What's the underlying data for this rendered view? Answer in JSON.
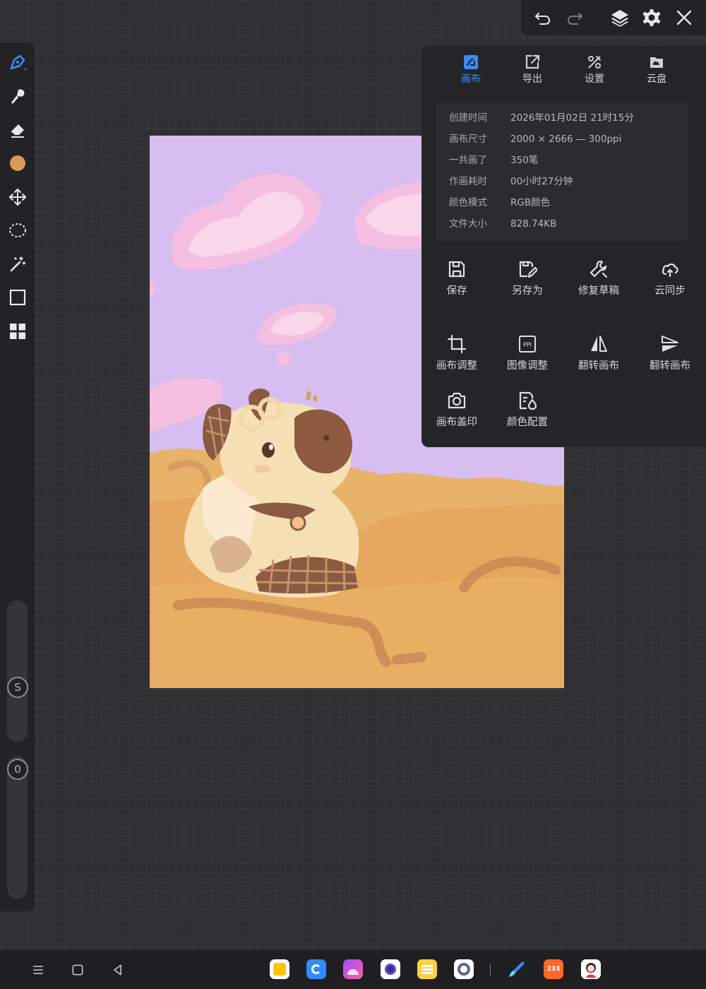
{
  "top_toolbar": {
    "icons": [
      "undo-icon",
      "redo-icon",
      "layers-icon",
      "gear-icon",
      "close-icon"
    ]
  },
  "left_toolbar": {
    "tools": [
      "pen-icon",
      "brush-icon",
      "eraser-icon",
      "color-swatch",
      "move-icon",
      "lasso-icon",
      "magic-wand-icon",
      "rectangle-select-icon",
      "grid-icon"
    ],
    "current_color": "#D89A5C",
    "size_slider_label": "S",
    "opacity_slider_label": "0"
  },
  "panel": {
    "tabs": [
      {
        "label": "画布",
        "icon": "canvas-icon",
        "active": true
      },
      {
        "label": "导出",
        "icon": "export-icon",
        "active": false
      },
      {
        "label": "设置",
        "icon": "settings-icon",
        "active": false
      },
      {
        "label": "云盘",
        "icon": "cloud-drive-icon",
        "active": false
      }
    ],
    "info": [
      {
        "label": "创建时间",
        "value": "2026年01月02日  21时15分"
      },
      {
        "label": "画布尺寸",
        "value": "2000 × 2666  —  300ppi"
      },
      {
        "label": "一共画了",
        "value": "350笔"
      },
      {
        "label": "作画耗时",
        "value": "00小时27分钟"
      },
      {
        "label": "颜色模式",
        "value": "RGB颜色"
      },
      {
        "label": "文件大小",
        "value": "828.74KB"
      }
    ],
    "actions": [
      {
        "label": "保存",
        "icon": "save-icon"
      },
      {
        "label": "另存为",
        "icon": "save-as-icon"
      },
      {
        "label": "修复草稿",
        "icon": "repair-icon"
      },
      {
        "label": "云同步",
        "icon": "cloud-sync-icon"
      },
      {
        "label": "画布调整",
        "icon": "crop-icon"
      },
      {
        "label": "图像调整",
        "icon": "ppi-icon"
      },
      {
        "label": "翻转画布",
        "icon": "flip-horizontal-icon"
      },
      {
        "label": "翻转画布",
        "icon": "flip-vertical-icon"
      },
      {
        "label": "画布盖印",
        "icon": "camera-icon"
      },
      {
        "label": "颜色配置",
        "icon": "color-config-icon"
      }
    ]
  },
  "colors": {
    "accent": "#3A8DFF",
    "panel_bg": "#252527",
    "canvas_sky": "#D7BDF0",
    "canvas_ground": "#E6A95F"
  },
  "bottom_nav": {
    "system_icons": [
      "menu-icon",
      "home-icon",
      "back-icon"
    ],
    "dock_apps": [
      {
        "icon": "notes-app-icon",
        "label": ""
      },
      {
        "icon": "browser-app-icon",
        "label": ""
      },
      {
        "icon": "gallery-app-icon",
        "label": ""
      },
      {
        "icon": "camera-app-icon",
        "label": ""
      },
      {
        "icon": "memo-app-icon",
        "label": ""
      },
      {
        "icon": "settings-app-icon",
        "label": ""
      },
      {
        "icon": "paint-app-icon",
        "label": ""
      },
      {
        "icon": "game-app-icon",
        "label": "233"
      },
      {
        "icon": "avatar-app-icon",
        "label": ""
      }
    ]
  }
}
